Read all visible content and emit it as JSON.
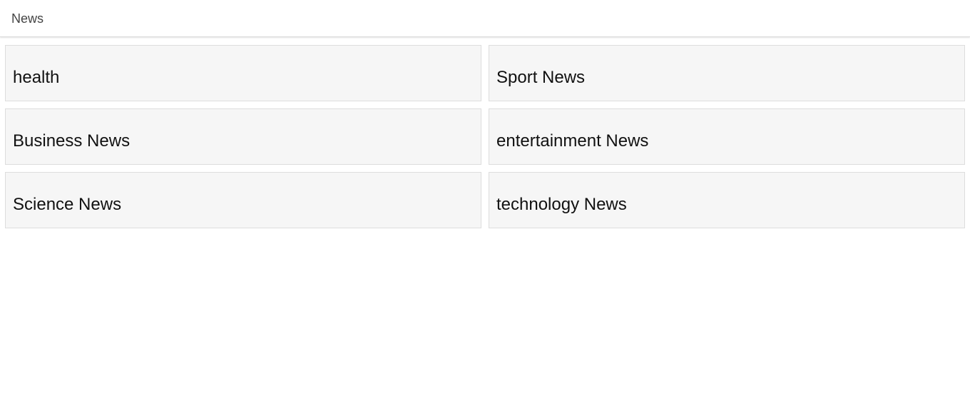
{
  "header": {
    "title": "News"
  },
  "categories": [
    {
      "label": "health"
    },
    {
      "label": "Sport News"
    },
    {
      "label": "Business News"
    },
    {
      "label": "entertainment News"
    },
    {
      "label": "Science News"
    },
    {
      "label": "technology News"
    }
  ]
}
